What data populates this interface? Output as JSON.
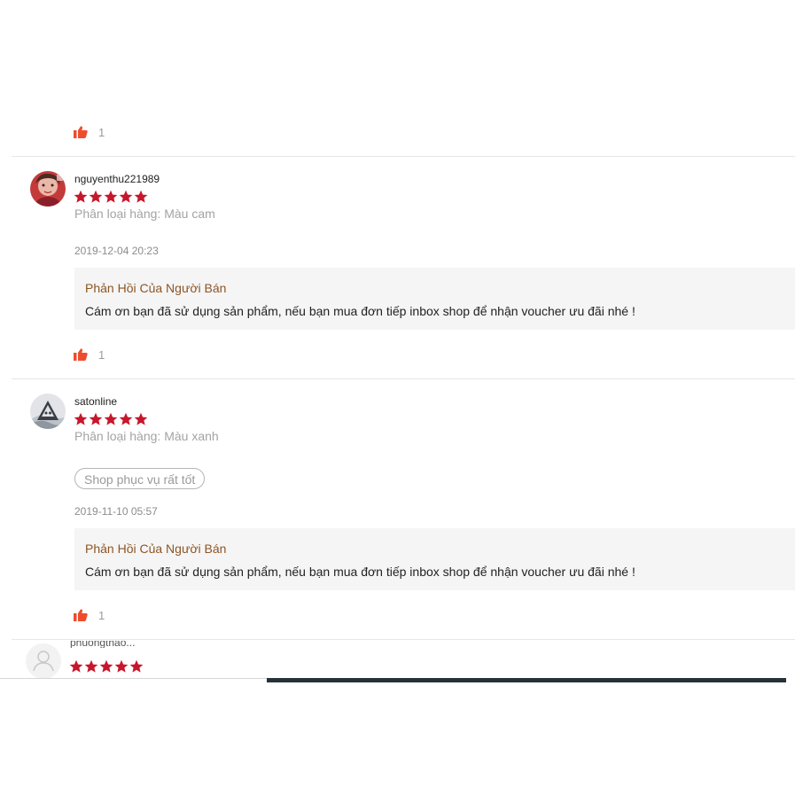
{
  "colors": {
    "star": "#c7172c",
    "like": "#ee4d2d",
    "reply_title": "#8d5524",
    "reply_bg": "#f5f5f5"
  },
  "top_like": {
    "icon": "thumbs-up-icon",
    "count": "1"
  },
  "reviews": [
    {
      "author": "nguyenthu221989",
      "rating": 5,
      "variant": "Phân loại hàng: Màu cam",
      "date": "2019-12-04 20:23",
      "reply": {
        "title": "Phản Hồi Của Người Bán",
        "text": "Cám ơn bạn đã sử dụng sản phẩm, nếu bạn mua đơn tiếp inbox shop để nhận voucher ưu đãi nhé  !"
      },
      "likes": "1"
    },
    {
      "author": "satonline",
      "rating": 5,
      "variant": "Phân loại hàng: Màu xanh",
      "tag": "Shop phục vụ rất tốt",
      "date": "2019-11-10 05:57",
      "reply": {
        "title": "Phản Hồi Của Người Bán",
        "text": "Cám ơn bạn đã sử dụng sản phẩm, nếu bạn mua đơn tiếp inbox shop để nhận voucher ưu đãi nhé  !"
      },
      "likes": "1"
    },
    {
      "author": "phuongthao...",
      "rating": 5
    }
  ]
}
